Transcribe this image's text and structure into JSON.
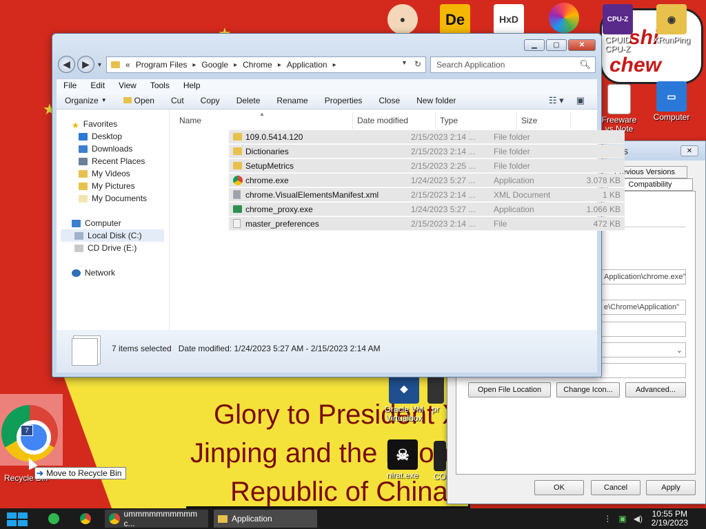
{
  "explorer": {
    "breadcrumb": [
      "Program Files",
      "Google",
      "Chrome",
      "Application"
    ],
    "breadcrumb_prefix": "«",
    "search_placeholder": "Search Application",
    "menu": [
      "File",
      "Edit",
      "View",
      "Tools",
      "Help"
    ],
    "commands": {
      "organize": "Organize",
      "open": "Open",
      "cut": "Cut",
      "copy": "Copy",
      "delete": "Delete",
      "rename": "Rename",
      "properties": "Properties",
      "close": "Close",
      "new_folder": "New folder"
    },
    "nav": {
      "favorites": "Favorites",
      "desktop": "Desktop",
      "downloads": "Downloads",
      "recent_places": "Recent Places",
      "my_videos": "My Videos",
      "my_pictures": "My Pictures",
      "my_documents": "My Documents",
      "computer": "Computer",
      "local_disk": "Local Disk (C:)",
      "cd_drive": "CD Drive (E:)",
      "network": "Network"
    },
    "columns": {
      "name": "Name",
      "date": "Date modified",
      "type": "Type",
      "size": "Size"
    },
    "files": [
      {
        "name": "109.0.5414.120",
        "date": "2/15/2023 2:14 ...",
        "type": "File folder",
        "size": "",
        "icon": "folder-icon",
        "color": "#e8c04c"
      },
      {
        "name": "Dictionaries",
        "date": "2/15/2023 2:14 ...",
        "type": "File folder",
        "size": "",
        "icon": "folder-icon",
        "color": "#e8c04c"
      },
      {
        "name": "SetupMetrics",
        "date": "2/15/2023 2:25 ...",
        "type": "File folder",
        "size": "",
        "icon": "folder-icon",
        "color": "#e8c04c"
      },
      {
        "name": "chrome.exe",
        "date": "1/24/2023 5:27 ...",
        "type": "Application",
        "size": "3.078 KB",
        "icon": "chrome-icon",
        "color": "#db4437"
      },
      {
        "name": "chrome.VisualElementsManifest.xml",
        "date": "2/15/2023 2:14 ...",
        "type": "XML Document",
        "size": "1 KB",
        "icon": "xml-file-icon",
        "color": "#9aa3ad"
      },
      {
        "name": "chrome_proxy.exe",
        "date": "1/24/2023 5:27 ...",
        "type": "Application",
        "size": "1.066 KB",
        "icon": "exe-icon",
        "color": "#2f8f4f"
      },
      {
        "name": "master_preferences",
        "date": "2/15/2023 2:14 ...",
        "type": "File",
        "size": "472 KB",
        "icon": "file-icon",
        "color": "#f2f2f2"
      }
    ],
    "details": {
      "selected": "7 items selected",
      "date_label": "Date modified:",
      "date_range": "1/24/2023 5:27 AM - 2/15/2023 2:14 AM"
    }
  },
  "properties_dialog": {
    "title": "perties",
    "tabs": [
      "Previous Versions",
      "Compatibility"
    ],
    "target": "Application\\chrome.exe\"",
    "start_in": "e\\Chrome\\Application\"",
    "buttons": {
      "open_location": "Open File Location",
      "change_icon": "Change Icon...",
      "advanced": "Advanced...",
      "ok": "OK",
      "cancel": "Cancel",
      "apply": "Apply"
    }
  },
  "desktop": {
    "poster_lines": [
      "Glory to President Xi",
      "Jinping and the Peopl",
      "Republic of China"
    ],
    "sticker_text_1": "shi",
    "sticker_text_2": "chew",
    "icons": {
      "cpuz": "CPUID\nCPU-Z",
      "xrunping": "XRunPing",
      "freeware": "Freeware\nys Note",
      "computer": "Computer",
      "virtualbox": "Oracle VM\nVirtualbox",
      "nirat": "nirat.exe",
      "recycle": "Recycle Bin",
      "pr": "pr",
      "co": "CO"
    },
    "drag_badge": "7",
    "drag_tooltip": "Move to Recycle Bin"
  },
  "taskbar": {
    "chrome_task": "ummmmmmmmmm c...",
    "explorer_task": "Application",
    "time": "10:55 PM",
    "date": "2/19/2023"
  }
}
